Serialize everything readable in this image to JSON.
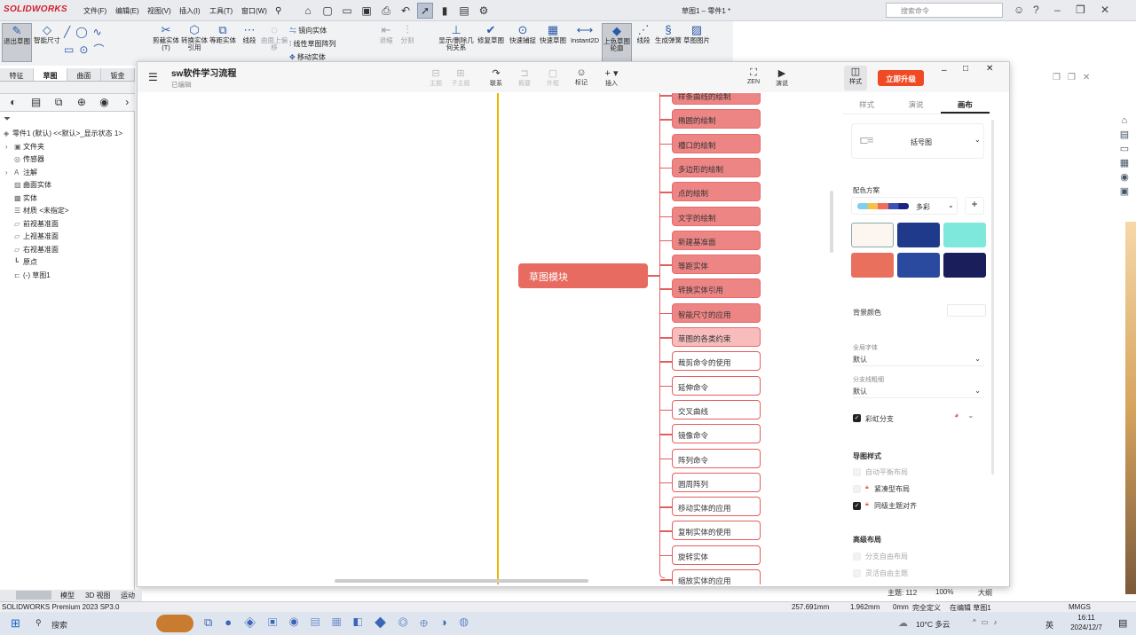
{
  "app": {
    "name": "SOLIDWORKS",
    "doc_title": "草图1 – 零件1 *",
    "search_placeholder": "搜索命令"
  },
  "menus": [
    "文件(F)",
    "编辑(E)",
    "视图(V)",
    "插入(I)",
    "工具(T)",
    "窗口(W)"
  ],
  "commands": [
    {
      "label": "退出草图",
      "icon": "exit-sketch-icon"
    },
    {
      "label": "智能尺寸",
      "icon": "smart-dimension-icon"
    },
    {
      "label": "剪裁实体(T)",
      "icon": "trim-icon"
    },
    {
      "label": "转换实体引用",
      "icon": "convert-icon"
    },
    {
      "label": "等距实体",
      "icon": "offset-icon"
    },
    {
      "label": "线段",
      "icon": "segment-icon"
    },
    {
      "label": "曲面上偏移",
      "icon": "surface-offset-icon"
    },
    {
      "label": "镜向实体",
      "icon": "mirror-icon"
    },
    {
      "label": "线性草图阵列",
      "icon": "linear-pattern-icon"
    },
    {
      "label": "移动实体",
      "icon": "move-icon"
    },
    {
      "label": "退缩",
      "icon": "retract-icon"
    },
    {
      "label": "分割",
      "icon": "split-icon"
    },
    {
      "label": "显示/删除几何关系",
      "icon": "relations-icon"
    },
    {
      "label": "修复草图",
      "icon": "repair-icon"
    },
    {
      "label": "快速捕捉",
      "icon": "snap-icon"
    },
    {
      "label": "快速草图",
      "icon": "quick-sketch-icon"
    },
    {
      "label": "Instant2D",
      "icon": "instant2d-icon"
    },
    {
      "label": "上色草图轮廓",
      "icon": "shade-icon"
    },
    {
      "label": "线段",
      "icon": "segment-icon"
    },
    {
      "label": "生成弹簧",
      "icon": "spring-icon"
    },
    {
      "label": "草图图片",
      "icon": "sketch-picture-icon"
    }
  ],
  "feature_tabs": [
    "特征",
    "草图",
    "曲面",
    "钣金"
  ],
  "tree": {
    "root": "零件1 (默认) <<默认>_显示状态 1>",
    "items": [
      "文件夹",
      "传感器",
      "注解",
      "曲面实体",
      "实体",
      "材质 <未指定>",
      "前视基准面",
      "上视基准面",
      "右视基准面",
      "原点",
      "(-) 草图1"
    ]
  },
  "bottom_tabs": [
    "模型",
    "3D 视图",
    "运动"
  ],
  "status": {
    "app_version": "SOLIDWORKS Premium 2023 SP3.0",
    "x": "257.691mm",
    "y": "1.962mm",
    "z": "0mm",
    "state": "完全定义",
    "editing": "在编辑 草图1",
    "units": "MMGS"
  },
  "taskbar": {
    "search": "搜索",
    "weather": "10°C 多云",
    "lang": "英",
    "time": "16:11",
    "date": "2024/12/7"
  },
  "mindmap": {
    "title": "sw软件学习流程",
    "subtitle": "已编辑",
    "toolbar": [
      "主题",
      "子主题",
      "联系",
      "概要",
      "外框",
      "标记",
      "插入"
    ],
    "right_toolbar": [
      "ZEN",
      "演说"
    ],
    "style_label": "样式",
    "upgrade": "立即升级",
    "central": "草图模块",
    "nodes": [
      {
        "label": "样条曲线的绘制",
        "fill": "filled"
      },
      {
        "label": "椭圆的绘制",
        "fill": "filled"
      },
      {
        "label": "槽口的绘制",
        "fill": "filled"
      },
      {
        "label": "多边形的绘制",
        "fill": "filled"
      },
      {
        "label": "点的绘制",
        "fill": "filled"
      },
      {
        "label": "文字的绘制",
        "fill": "filled"
      },
      {
        "label": "新建基准面",
        "fill": "filled"
      },
      {
        "label": "等距实体",
        "fill": "filled"
      },
      {
        "label": "转换实体引用",
        "fill": "filled"
      },
      {
        "label": "智能尺寸的应用",
        "fill": "filled"
      },
      {
        "label": "草图的各类约束",
        "fill": "light"
      },
      {
        "label": "裁剪命令的使用",
        "fill": "outline"
      },
      {
        "label": "延伸命令",
        "fill": "outline"
      },
      {
        "label": "交叉曲线",
        "fill": "outline"
      },
      {
        "label": "镜像命令",
        "fill": "outline"
      },
      {
        "label": "阵列命令",
        "fill": "outline"
      },
      {
        "label": "圆周阵列",
        "fill": "outline"
      },
      {
        "label": "移动实体的应用",
        "fill": "outline"
      },
      {
        "label": "复制实体的使用",
        "fill": "outline"
      },
      {
        "label": "旋转实体",
        "fill": "outline"
      },
      {
        "label": "缩放实体的应用",
        "fill": "outline"
      }
    ],
    "panel": {
      "tabs": [
        "样式",
        "演说",
        "画布"
      ],
      "active_tab": "画布",
      "layout": "括号图",
      "color_scheme_label": "配色方案",
      "color_scheme": "多彩",
      "bg_color_label": "背景颜色",
      "font_label": "全局字体",
      "font_value": "默认",
      "branch_label": "分支线粗细",
      "branch_value": "默认",
      "rainbow": "彩虹分支",
      "map_style_label": "导图样式",
      "map_style_items": [
        "自动平衡布局",
        "紧凑型布局",
        "同级主题对齐"
      ],
      "advanced_label": "高级布局",
      "advanced_items": [
        "分支自由布局",
        "灵活自由主题"
      ]
    },
    "footer": {
      "topic_count": "主题: 112",
      "zoom": "100%",
      "size": "大纲"
    }
  },
  "colors": {
    "accent": "#e35e5e",
    "trunk": "#f0b400",
    "upgrade": "#f04a24"
  }
}
